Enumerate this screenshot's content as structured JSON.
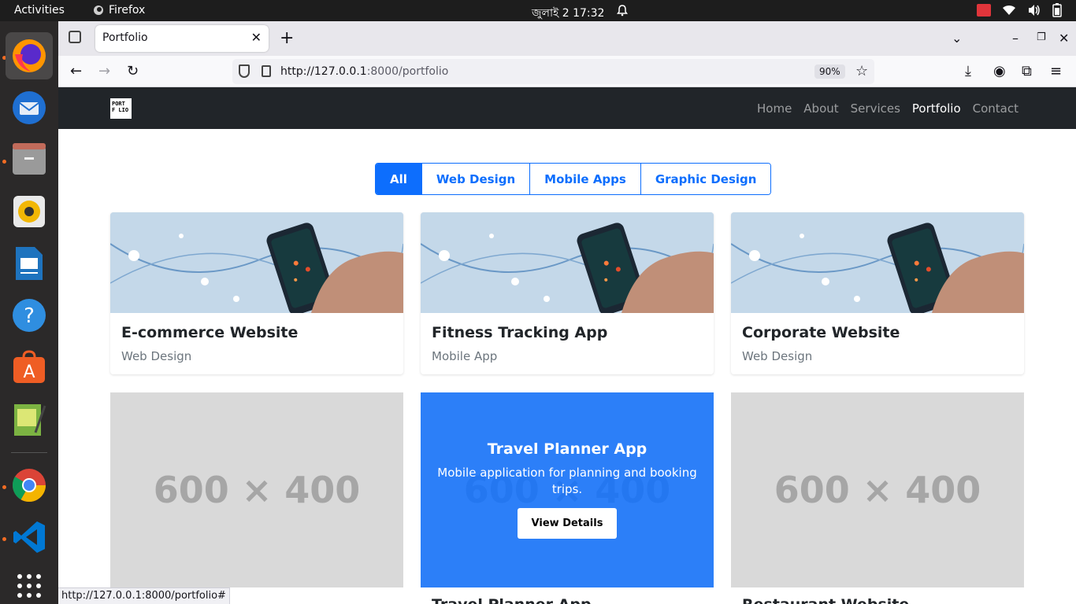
{
  "os": {
    "activities": "Activities",
    "app_name": "Firefox",
    "clock": "জুলাই 2  17:32"
  },
  "browser": {
    "tab_title": "Portfolio",
    "url_host": "http://127.0.0.1",
    "url_path": ":8000/portfolio",
    "zoom": "90%",
    "status_url": "http://127.0.0.1:8000/portfolio#"
  },
  "site": {
    "logo": "PORTFOLIO",
    "nav": [
      "Home",
      "About",
      "Services",
      "Portfolio",
      "Contact"
    ],
    "nav_active": "Portfolio"
  },
  "filters": [
    "All",
    "Web Design",
    "Mobile Apps",
    "Graphic Design"
  ],
  "cards": [
    {
      "title": "E-commerce Website",
      "category": "Web Design"
    },
    {
      "title": "Fitness Tracking App",
      "category": "Mobile App"
    },
    {
      "title": "Corporate Website",
      "category": "Web Design"
    }
  ],
  "placeholders": {
    "label": "600 × 400"
  },
  "hover_card": {
    "title": "Travel Planner App",
    "description": "Mobile application for planning and booking trips.",
    "button": "View Details"
  },
  "bottom_titles": [
    "Travel Planner App",
    "Restaurant Website"
  ]
}
